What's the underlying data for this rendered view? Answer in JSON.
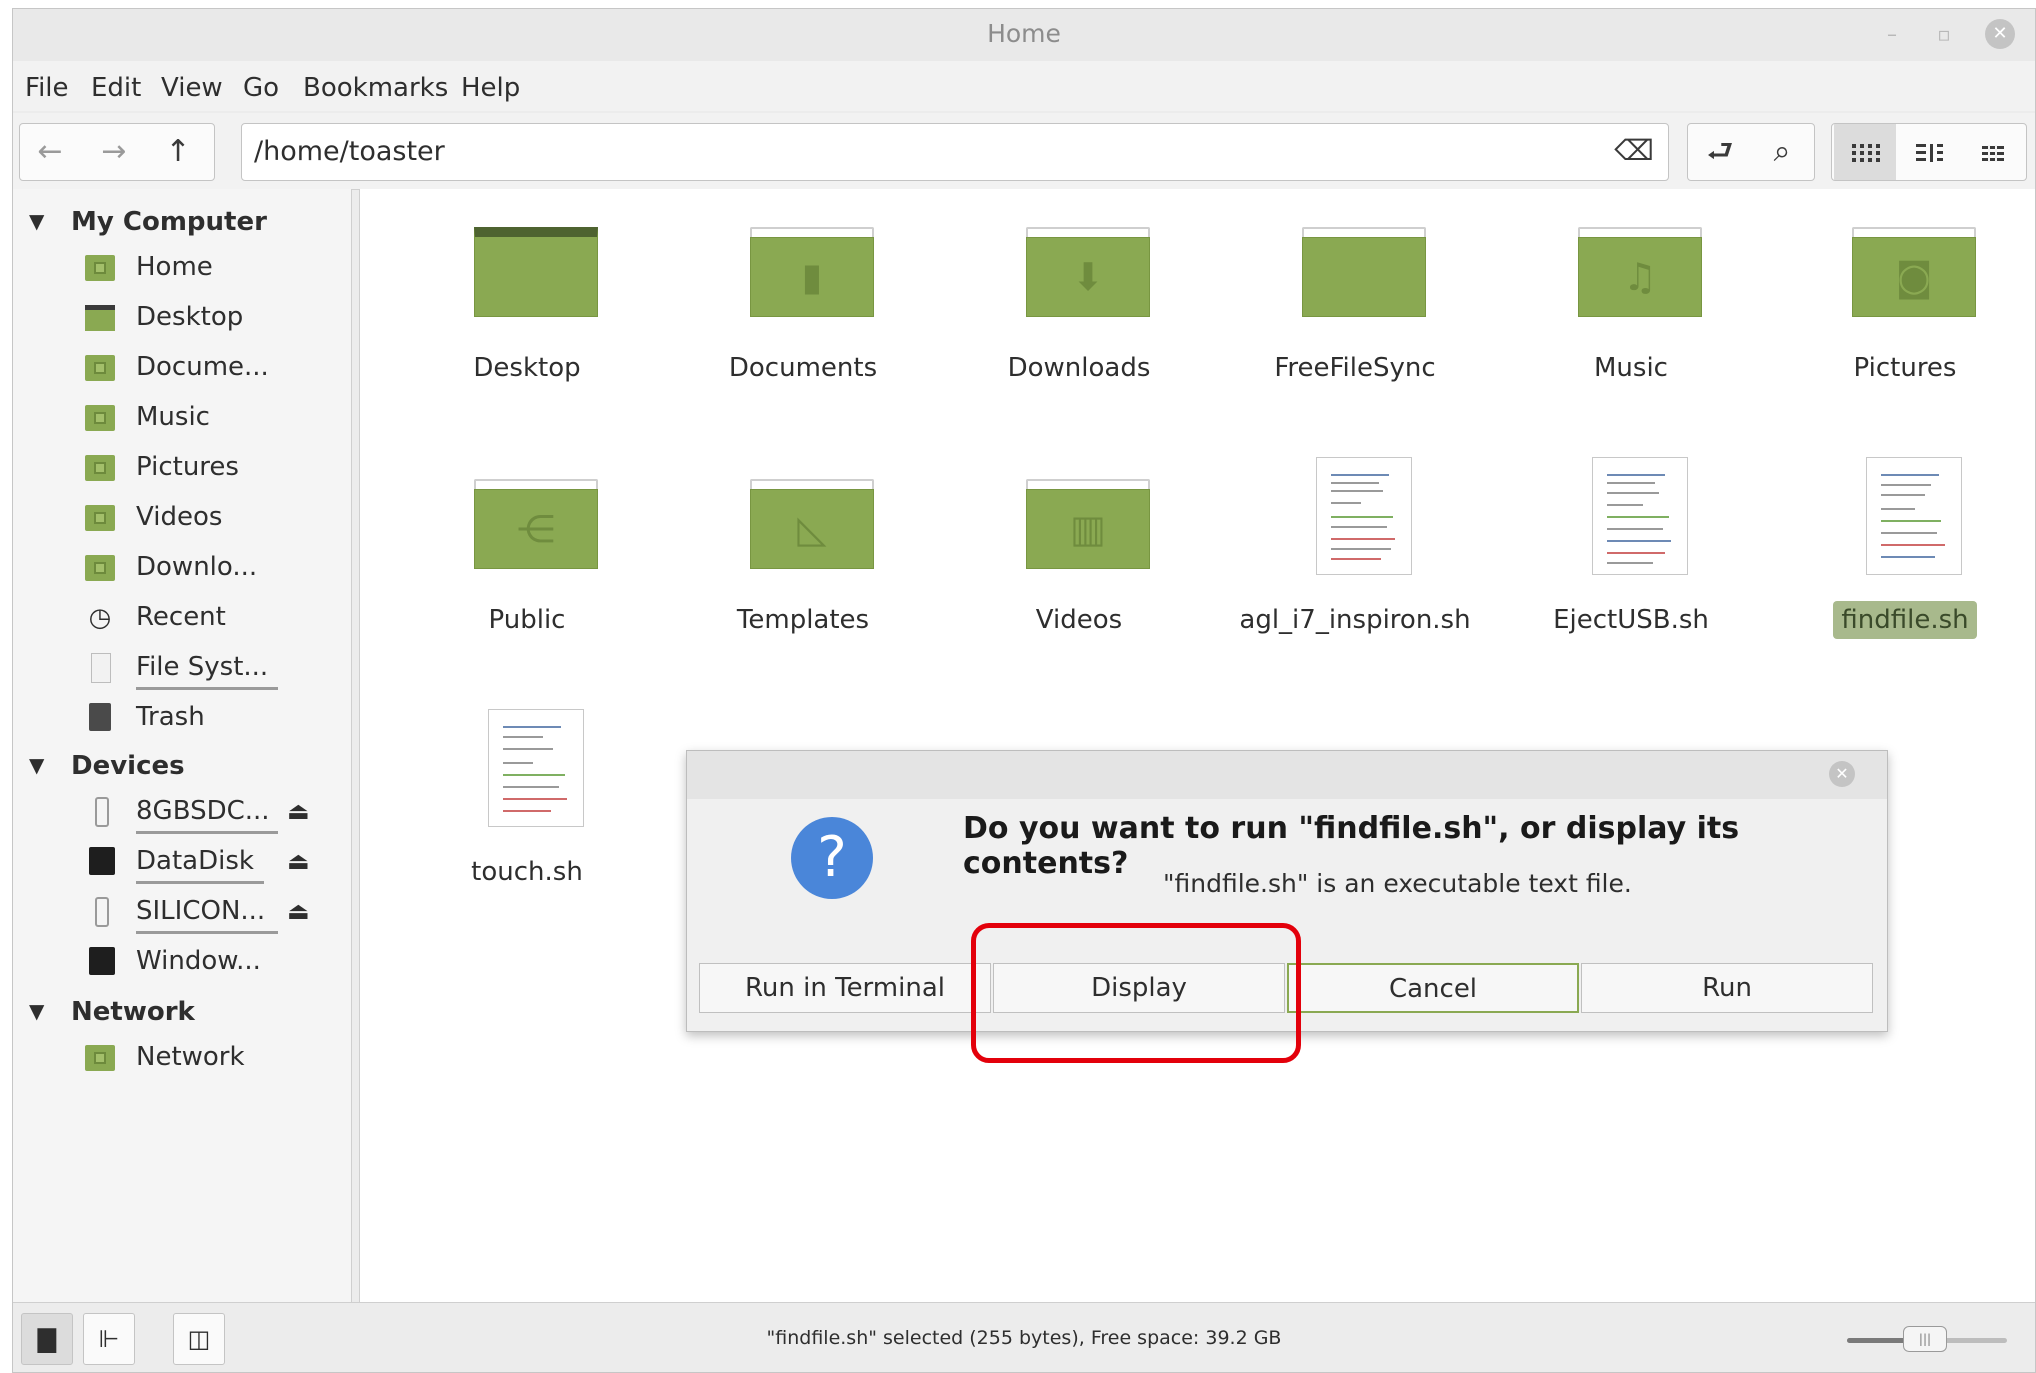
{
  "window": {
    "title": "Home"
  },
  "menubar": {
    "items": [
      "File",
      "Edit",
      "View",
      "Go",
      "Bookmarks",
      "Help"
    ]
  },
  "toolbar": {
    "path": "/home/toaster"
  },
  "sidebar": {
    "sections": [
      {
        "label": "My Computer",
        "items": [
          {
            "label": "Home",
            "icon": "home-folder-icon"
          },
          {
            "label": "Desktop",
            "icon": "desktop-icon"
          },
          {
            "label": "Docume...",
            "icon": "documents-folder-icon"
          },
          {
            "label": "Music",
            "icon": "music-folder-icon"
          },
          {
            "label": "Pictures",
            "icon": "pictures-folder-icon"
          },
          {
            "label": "Videos",
            "icon": "videos-folder-icon"
          },
          {
            "label": "Downlo...",
            "icon": "downloads-folder-icon"
          },
          {
            "label": "Recent",
            "icon": "clock-icon"
          },
          {
            "label": "File Syst...",
            "icon": "drive-icon"
          },
          {
            "label": "Trash",
            "icon": "trash-icon"
          }
        ]
      },
      {
        "label": "Devices",
        "items": [
          {
            "label": "8GBSDC...",
            "icon": "usb-drive-icon"
          },
          {
            "label": "DataDisk",
            "icon": "hard-disk-icon"
          },
          {
            "label": "SILICON...",
            "icon": "usb-drive-icon"
          },
          {
            "label": "Window...",
            "icon": "hard-disk-icon"
          }
        ]
      },
      {
        "label": "Network",
        "items": [
          {
            "label": "Network",
            "icon": "network-folder-icon"
          }
        ]
      }
    ]
  },
  "files": [
    {
      "name": "Desktop",
      "type": "desktop-folder"
    },
    {
      "name": "Documents",
      "type": "documents-folder"
    },
    {
      "name": "Downloads",
      "type": "downloads-folder"
    },
    {
      "name": "FreeFileSync",
      "type": "folder"
    },
    {
      "name": "Music",
      "type": "music-folder"
    },
    {
      "name": "Pictures",
      "type": "pictures-folder"
    },
    {
      "name": "Public",
      "type": "public-folder"
    },
    {
      "name": "Templates",
      "type": "templates-folder"
    },
    {
      "name": "Videos",
      "type": "videos-folder"
    },
    {
      "name": "agl_i7_inspiron.sh",
      "type": "script"
    },
    {
      "name": "EjectUSB.sh",
      "type": "script"
    },
    {
      "name": "findfile.sh",
      "type": "script",
      "selected": true
    },
    {
      "name": "touch.sh",
      "type": "script"
    }
  ],
  "dialog": {
    "heading": "Do you want to run \"findfile.sh\", or display its contents?",
    "message": "\"findfile.sh\" is an executable text file.",
    "buttons": [
      "Run in Terminal",
      "Display",
      "Cancel",
      "Run"
    ]
  },
  "statusbar": {
    "text": "\"findfile.sh\" selected (255 bytes), Free space: 39.2 GB"
  },
  "colors": {
    "folder_green": "#8aa952",
    "accent_blue": "#4a86d9",
    "highlight_red": "#e3000b"
  }
}
